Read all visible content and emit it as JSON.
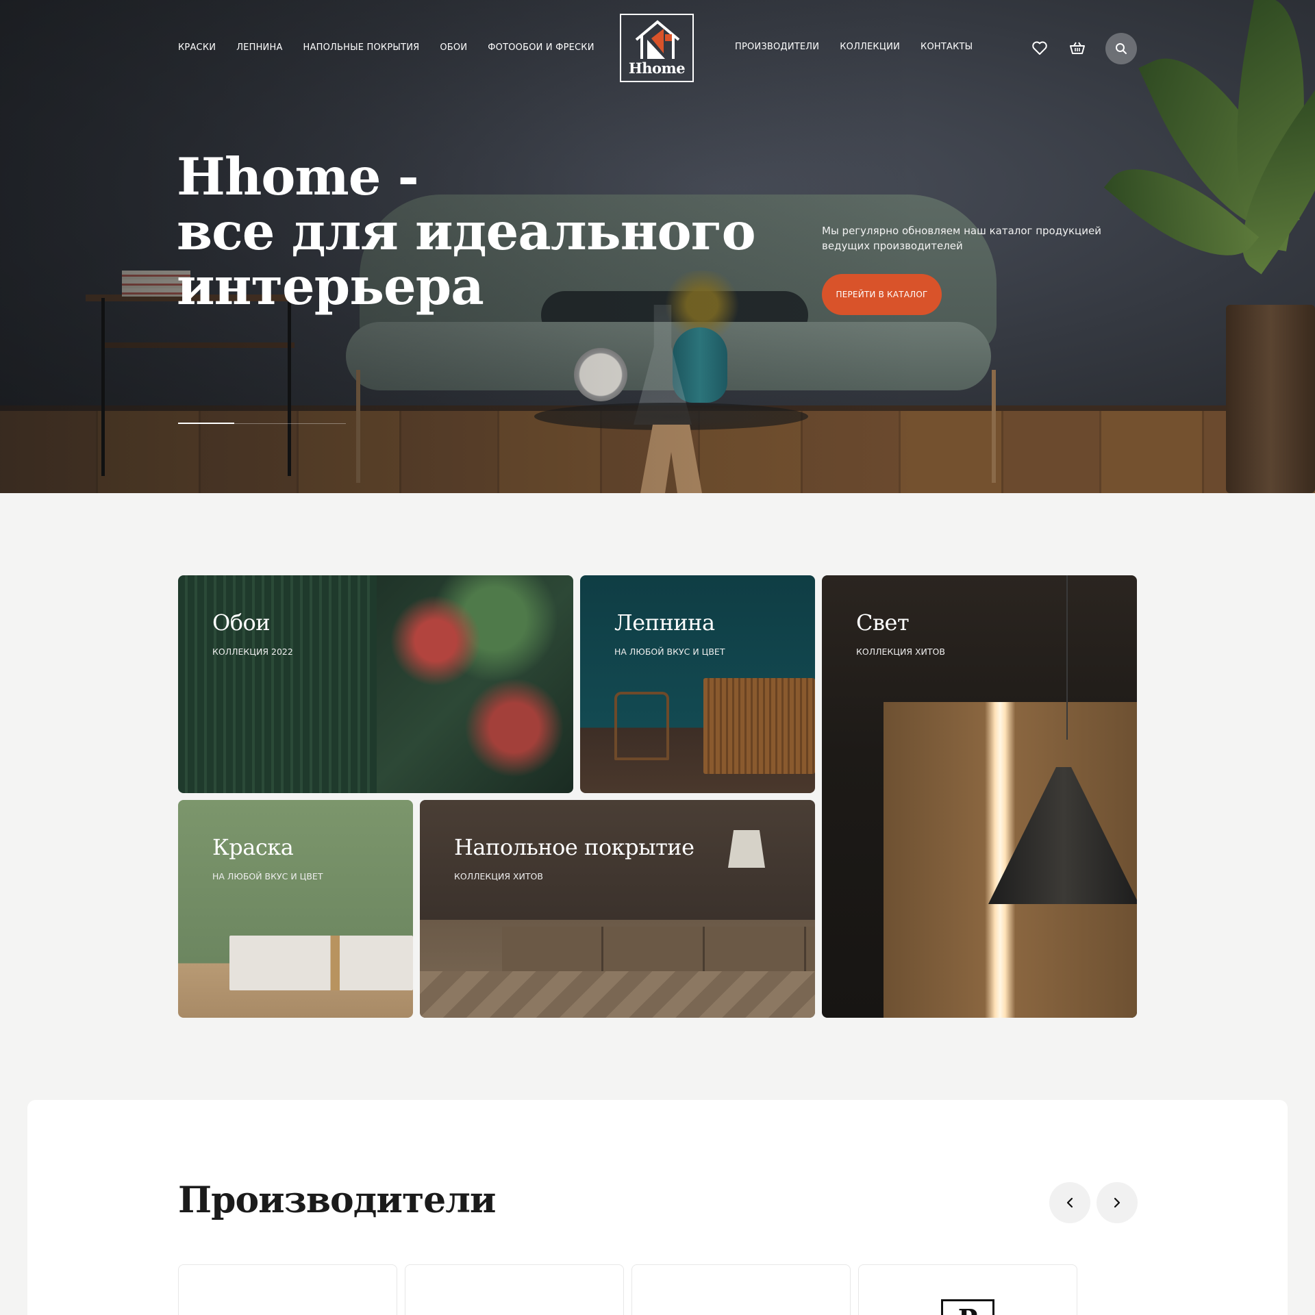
{
  "header": {
    "nav_left": [
      "КРАСКИ",
      "ЛЕПНИНА",
      "НАПОЛЬНЫЕ ПОКРЫТИЯ",
      "ОБОИ",
      "ФОТООБОИ И ФРЕСКИ"
    ],
    "nav_right": [
      "ПРОИЗВОДИТЕЛИ",
      "КОЛЛЕКЦИИ",
      "КОНТАКТЫ"
    ],
    "logo_text": "Hhome",
    "icons": [
      "heart-icon",
      "basket-icon",
      "search-icon"
    ]
  },
  "hero": {
    "title_lines": [
      "Hhome -",
      "все для идеального",
      "интерьера"
    ],
    "subtitle": "Мы регулярно обновляем наш каталог продукцией ведущих производителей",
    "cta_label": "ПЕРЕЙТИ В КАТАЛОГ",
    "slider": {
      "current": 1,
      "total": 3
    }
  },
  "categories": [
    {
      "title": "Обои",
      "subtitle": "КОЛЛЕКЦИЯ 2022"
    },
    {
      "title": "Лепнина",
      "subtitle": "НА ЛЮБОЙ ВКУС И ЦВЕТ"
    },
    {
      "title": "Свет",
      "subtitle": "КОЛЛЕКЦИЯ ХИТОВ"
    },
    {
      "title": "Краска",
      "subtitle": "НА ЛЮБОЙ ВКУС И ЦВЕТ"
    },
    {
      "title": "Напольное покрытие",
      "subtitle": "КОЛЛЕКЦИЯ ХИТОВ"
    }
  ],
  "manufacturers": {
    "title": "Производители",
    "prev_icon": "chevron-left-icon",
    "next_icon": "chevron-right-icon",
    "visible_logo_letter": "P"
  },
  "colors": {
    "accent": "#d9532a",
    "text_dark": "#1b1b1b",
    "page_bg": "#f4f4f3",
    "logo_roof": "#d9532a"
  }
}
